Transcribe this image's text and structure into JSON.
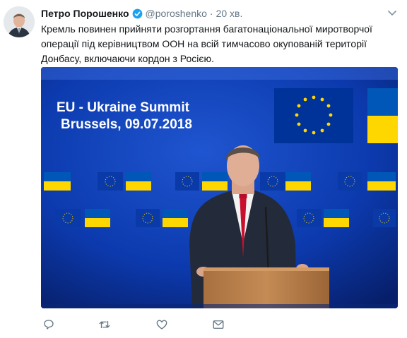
{
  "tweet": {
    "author_name": "Петро Порошенко",
    "handle": "@poroshenko",
    "separator": "·",
    "time": "20 хв.",
    "text": "Кремль повинен прийняти розгортання багатонаціональної миротворчої операції під керівництвом ООН на всій тимчасово окупованій території Донбасу, включаючи кордон з Росією."
  },
  "media": {
    "banner_line1": "EU - Ukraine Summit",
    "banner_line2": "Brussels, 09.07.2018"
  },
  "icons": {
    "avatar": "avatar-photo",
    "verified": "verified-badge-icon",
    "caret": "chevron-down-icon",
    "reply": "reply-icon",
    "retweet": "retweet-icon",
    "like": "heart-icon",
    "dm": "envelope-icon"
  },
  "colors": {
    "text": "#14171a",
    "secondary": "#657786",
    "verified": "#1da1f2",
    "eu_blue": "#003399",
    "ukraine_blue": "#0057b7",
    "ukraine_yellow": "#ffd700"
  }
}
